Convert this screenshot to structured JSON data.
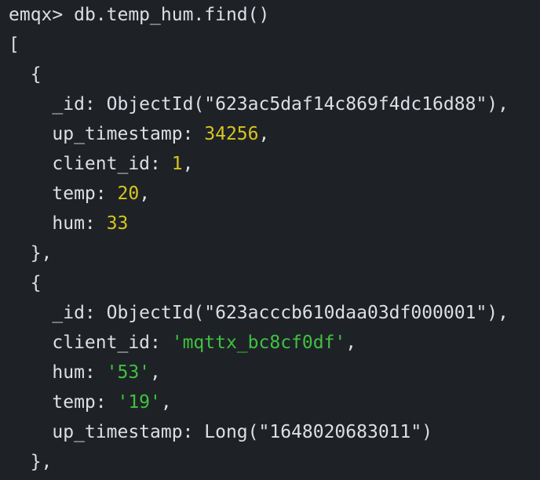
{
  "terminal": {
    "prompt": "emqx> ",
    "command": "db.temp_hum.find()",
    "indent1": "  ",
    "indent2": "    ",
    "open_bracket": "[",
    "open_brace": "{",
    "close_brace": "},",
    "comma": ",",
    "doc1": {
      "id_key": "_id: ",
      "id_value": "ObjectId(\"623ac5daf14c869f4dc16d88\")",
      "ts_key": "up_timestamp: ",
      "ts_value": "34256",
      "client_key": "client_id: ",
      "client_value": "1",
      "temp_key": "temp: ",
      "temp_value": "20",
      "hum_key": "hum: ",
      "hum_value": "33"
    },
    "doc2": {
      "id_key": "_id: ",
      "id_value": "ObjectId(\"623acccb610daa03df000001\")",
      "client_key": "client_id: ",
      "client_value": "'mqttx_bc8cf0df'",
      "hum_key": "hum: ",
      "hum_value": "'53'",
      "temp_key": "temp: ",
      "temp_value": "'19'",
      "ts_key": "up_timestamp: ",
      "ts_value": "Long(\"1648020683011\")"
    },
    "colors": {
      "background": "#1e2227",
      "text": "#dcdfe4",
      "number": "#d7c51f",
      "string": "#3fc23f"
    }
  }
}
